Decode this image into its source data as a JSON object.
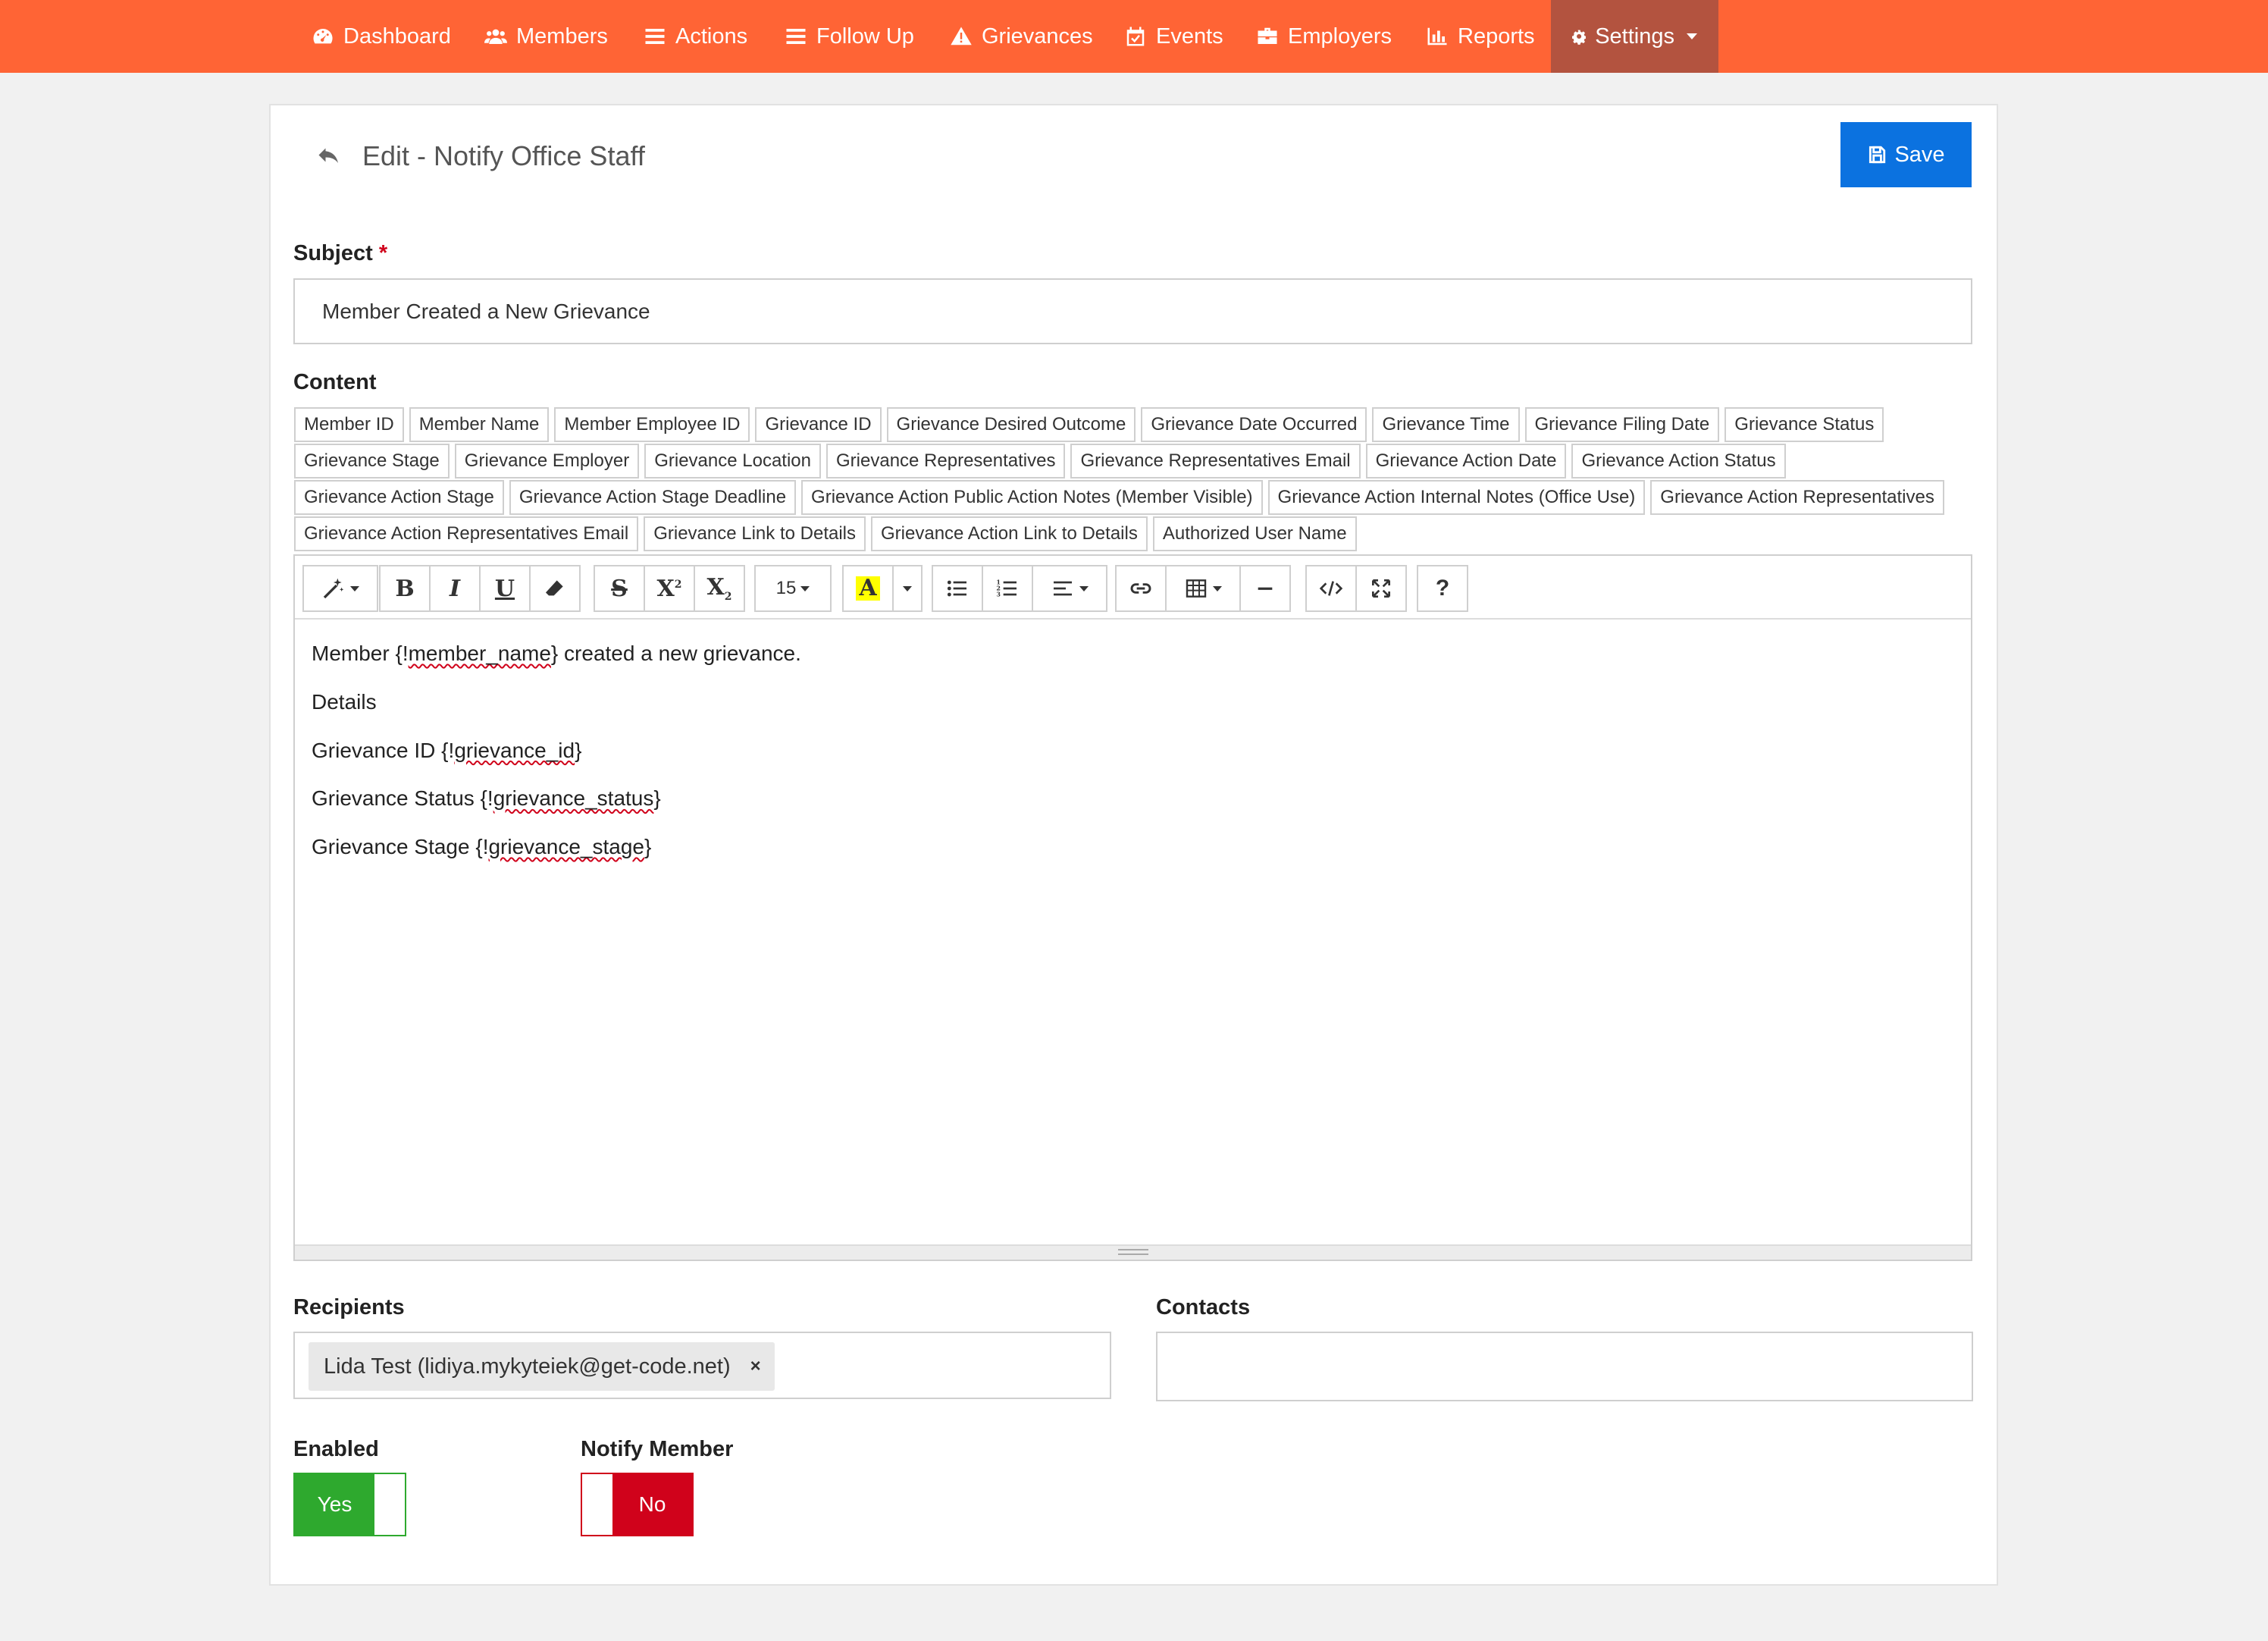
{
  "nav": {
    "items": [
      {
        "label": "Dashboard",
        "icon": "dashboard-icon"
      },
      {
        "label": "Members",
        "icon": "users-icon"
      },
      {
        "label": "Actions",
        "icon": "list-icon"
      },
      {
        "label": "Follow Up",
        "icon": "follow-up-icon"
      },
      {
        "label": "Grievances",
        "icon": "warning-icon"
      },
      {
        "label": "Events",
        "icon": "calendar-check-icon"
      },
      {
        "label": "Employers",
        "icon": "briefcase-icon"
      },
      {
        "label": "Reports",
        "icon": "bar-chart-icon"
      },
      {
        "label": "Settings",
        "icon": "gear-icon"
      }
    ],
    "active": "Settings",
    "color": "#ff6435"
  },
  "page": {
    "title": "Edit - Notify Office Staff",
    "save_label": "Save"
  },
  "form": {
    "subject_label": "Subject",
    "subject_required": "*",
    "subject_value": "Member Created a New Grievance",
    "content_label": "Content",
    "tags": [
      "Member ID",
      "Member Name",
      "Member Employee ID",
      "Grievance ID",
      "Grievance Desired Outcome",
      "Grievance Date Occurred",
      "Grievance Time",
      "Grievance Filing Date",
      "Grievance Status",
      "Grievance Stage",
      "Grievance Employer",
      "Grievance Location",
      "Grievance Representatives",
      "Grievance Representatives Email",
      "Grievance Action Date",
      "Grievance Action Status",
      "Grievance Action Stage",
      "Grievance Action Stage Deadline",
      "Grievance Action Public Action Notes (Member Visible)",
      "Grievance Action Internal Notes (Office Use)",
      "Grievance Action Representatives",
      "Grievance Action Representatives Email",
      "Grievance Link to Details",
      "Grievance Action Link to Details",
      "Authorized User Name"
    ],
    "editor": {
      "font_size": "15",
      "content": {
        "line1_pre": "Member {!",
        "line1_var": "member_name",
        "line1_post": "} created a new grievance.",
        "line2": "Details",
        "line3_pre": "Grievance ID {!",
        "line3_var": "grievance_id",
        "line3_post": "}",
        "line4_pre": "Grievance Status {!",
        "line4_var": "grievance_status",
        "line4_post": "}",
        "line5_pre": "Grievance Stage {!",
        "line5_var": "grievance_stage",
        "line5_post": "}"
      }
    },
    "recipients_label": "Recipients",
    "recipient_chip": "Lida Test (lidiya.mykyteiek@get-code.net)",
    "recipient_remove": "×",
    "contacts_label": "Contacts",
    "enabled_label": "Enabled",
    "enabled_value": "Yes",
    "notify_member_label": "Notify Member",
    "notify_member_value": "No"
  }
}
